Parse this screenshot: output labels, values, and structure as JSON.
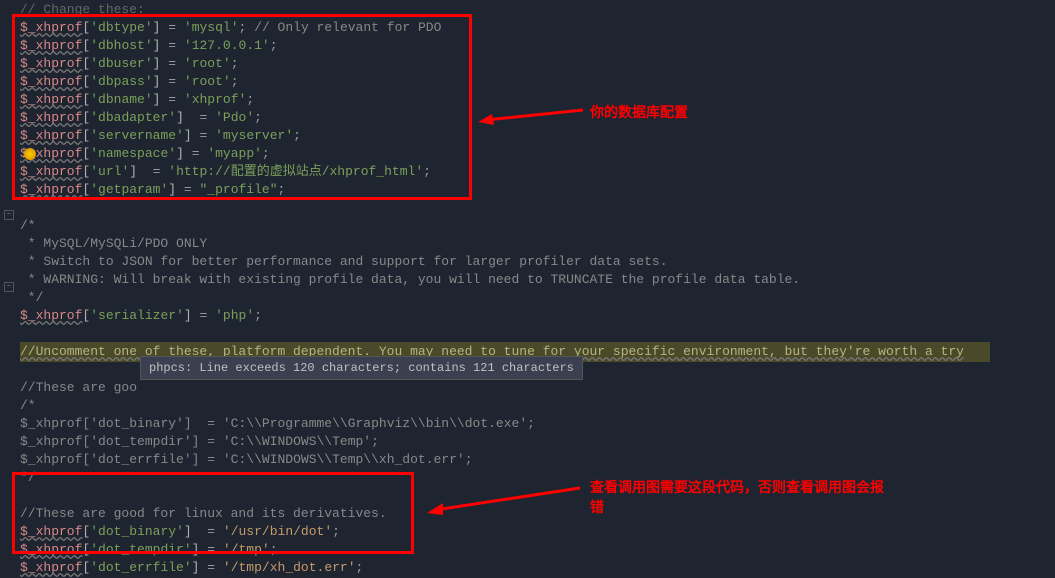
{
  "lines": {
    "l0": "// Change these:",
    "l1_var": "$_xhprof",
    "l1_k": "'dbtype'",
    "l1_v": "'mysql'",
    "l1_c": "// Only relevant for PDO",
    "l2_var": "$_xhprof",
    "l2_k": "'dbhost'",
    "l2_v": "'127.0.0.1'",
    "l3_var": "$_xhprof",
    "l3_k": "'dbuser'",
    "l3_v": "'root'",
    "l4_var": "$_xhprof",
    "l4_k": "'dbpass'",
    "l4_v": "'root'",
    "l5_var": "$_xhprof",
    "l5_k": "'dbname'",
    "l5_v": "'xhprof'",
    "l6_var": "$_xhprof",
    "l6_k": "'dbadapter'",
    "l6_v": "'Pdo'",
    "l7_var": "$_xhprof",
    "l7_k": "'servername'",
    "l7_v": "'myserver'",
    "l8_var": "$_xhprof",
    "l8_k": "'namespace'",
    "l8_v": "'myapp'",
    "l9_var": "$_xhprof",
    "l9_k": "'url'",
    "l9_v": "'http://配置的虚拟站点/xhprof_html'",
    "l10_var": "$_xhprof",
    "l10_k": "'getparam'",
    "l10_v": "\"_profile\"",
    "l12": "/*",
    "l13": " * MySQL/MySQLi/PDO ONLY",
    "l14": " * Switch to JSON for better performance and support for larger profiler data sets.",
    "l15": " * WARNING: Will break with existing profile data, you will need to TRUNCATE the profile data table.",
    "l16": " */",
    "l17_var": "$_xhprof",
    "l17_k": "'serializer'",
    "l17_v": "'php'",
    "l19": "//Uncomment one of these, platform dependent. You may need to tune for your specific environment, but they're worth a try",
    "l21": "//These are goo",
    "l22": "/*",
    "l23_var": "$_xhprof",
    "l23_k": "'dot_binary'",
    "l23_v": "'C:\\\\Programme\\\\Graphviz\\\\bin\\\\dot.exe'",
    "l24_var": "$_xhprof",
    "l24_k": "'dot_tempdir'",
    "l24_v": "'C:\\\\WINDOWS\\\\Temp'",
    "l25_var": "$_xhprof",
    "l25_k": "'dot_errfile'",
    "l25_v": "'C:\\\\WINDOWS\\\\Temp\\\\xh_dot.err'",
    "l26": "*/",
    "l28": "//These are good for linux and its derivatives.",
    "l29_var": "$_xhprof",
    "l29_k": "'dot_binary'",
    "l29_v": "'/usr/bin/dot'",
    "l30_var": "$_xhprof",
    "l30_k": "'dot_tempdir'",
    "l30_v": "'/tmp'",
    "l31_var": "$_xhprof",
    "l31_k": "'dot_errfile'",
    "l31_v": "'/tmp/xh_dot.err'"
  },
  "tooltip": "phpcs: Line exceeds 120 characters; contains 121 characters",
  "annotations": {
    "a1": "你的数据库配置",
    "a2": "查看调用图需要这段代码，否则查看调用图会报错"
  }
}
